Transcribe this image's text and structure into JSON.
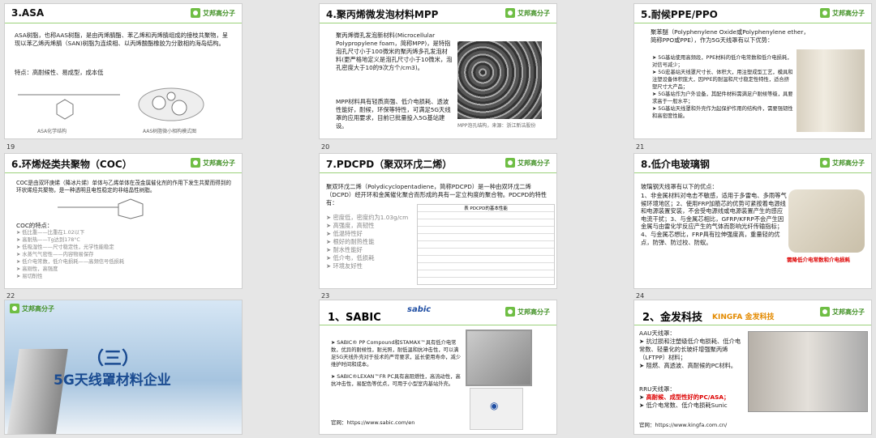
{
  "slides": [
    {
      "n": "19",
      "title": "3.ASA",
      "body1": "ASA树脂，也称AAS树脂，是由丙烯腈酯、苯乙烯和丙烯腈组成的接枝共聚物，呈现以苯乙烯丙烯腈（SAN)树脂为连续相、以丙烯酸酯橡胶为分散相的海岛结构。",
      "body2": "特点：高耐候性、易成型，成本低",
      "cap1": "ASA化学结构",
      "cap2": "AAS树脂微小相构模式图"
    },
    {
      "n": "20",
      "title": "4.聚丙烯微发泡材料MPP",
      "body1": "聚丙烯微孔发泡新材料(Microcellular Polypropylene foam，简称MPP)，是特指泡孔尺寸小于100微米的聚丙烯多孔发泡材料(更严格地定义是泡孔尺寸小于10微米，泡孔密度大于10的9次方个/cm3)。",
      "body2": "MPP材料具有轻质高强、低介电损耗、透波性能好，耐候，环保等特性，可满足5G天线罩的应用要求，目前已批量投入5G基站建设。",
      "cap": "MPP泡孔结构，来源：浙江新洁股份"
    },
    {
      "n": "21",
      "title": "5.耐候PPE/PPO",
      "body1": "聚苯醚（Polyphenylene Oxide或Polyphenylene ether，简称PPO或PPE），作为5G天线罩有以下优势：",
      "items": [
        "5G基站使用高频段，PPE材料的低介电常数和低介电损耗，对信号减少；",
        "5G宏基站天线罩尺寸长、体积大，用注塑成型工艺，模具和注塑设备体积庞大，因PPE的耐温和尺寸稳定性特性，适合挤塑尺寸大产品；",
        "5G基站作为户外设备，其配件材料需满足户耐候等级，具要求高于一般水平；",
        "5G基站天线罩和外壳作为起保护作用的结构件，需要强韧性和高密度性能。"
      ]
    },
    {
      "n": "22",
      "title": "6.环烯烃类共聚物（COC）",
      "body1": "COC是由双环庚烯（降冰片烯）单体与乙烯单体在茂金属催化剂的作用下发生共聚而得到的环状烯烃共聚物，是一种透明且电性稳定的非结晶性树脂。",
      "sub": "COC的特点：",
      "items": [
        "低比重——比重在1.02以下",
        "高耐热——Tg达到178°C",
        "低吸湿性——尺寸稳定性，光学性能稳定",
        "水蒸气气密性——内容物易保存",
        "低介电常数，低介电损耗——高频信号低损耗",
        "高刚性，高强度",
        "易切削性"
      ]
    },
    {
      "n": "23",
      "title": "7.PDCPD（聚双环戊二烯）",
      "body1": "聚双环戊二烯（Polydicyclopentadiene，简称PDCPD）是一种由双环戊二烯（DCPD）经开环和金属催化聚合而形成的具有一定立构度的聚合物。PDCPD的特性有：",
      "items": [
        "密度低，密度约为1.03g/cm",
        "高强度，高韧性",
        "低温特性好",
        "根好的耐热性能",
        "耐水性能好",
        "低介电，低损耗",
        "环境友好性"
      ],
      "table_title": "表 PDCPD的基本性能"
    },
    {
      "n": "24",
      "title": "8.低介电玻璃钢",
      "body1": "玻璃钢天线罩有以下的优点：",
      "body2": "1、非金属材料对电击不敏感，适用于多雷电、多雨等气候环境地区；2、使用FRP加筋芯的优势可紧按着电源线和电源装置安装，不会受电源线或电源装置产生的感应电流干扰；3、与金属芯相比，GFRP/KFRP不会产生因金属与由雷化学反应产生的气体而影响光纤传输指标；4、与金属芯想比，FRP具有拉伸强度高，重量轻的优点，防弹、防过校、防蚁。",
      "red": "需降低介电常数和介电损耗"
    },
    {
      "n": "",
      "title": "（三）",
      "sub": "5G天线罩材料企业"
    },
    {
      "n": "",
      "title": "1、SABIC",
      "brand": "sabic",
      "items": [
        "SABIC® PP Compound和STAMAX™具有低介电常数，优异的耐候性，耐光照，耐低温和抗冲击性，可以满足5G天线外壳对于技术的严苛要求，延长使用寿命，减少维护时间和成本。",
        "SABIC®LEXAN™FR PC具有高阻燃性，高流动性，高抗冲击性，易配色等优点，可用于小型室内基站外壳。"
      ],
      "url": "官网：https://www.sabic.com/en"
    },
    {
      "n": "",
      "title": "2、金发科技",
      "brand": "KINGFA 金发科技",
      "aau": "AAU天线罩：",
      "items_aau": [
        "抗过损和注塑级低介电损耗、低介电常数、轻量化的长玻纤增强聚丙烯（LFTPP）材料；",
        "阻燃、高透波、高耐候的PC材料。"
      ],
      "rru": "RRU天线罩：",
      "items_rru": [
        "高耐候、成型性好的PC/ASA；",
        "低介电常数、低介电损耗Sunic"
      ],
      "url": "官网：https://www.kingfa.com.cn/"
    }
  ],
  "logo_text": "艾邦高分子"
}
